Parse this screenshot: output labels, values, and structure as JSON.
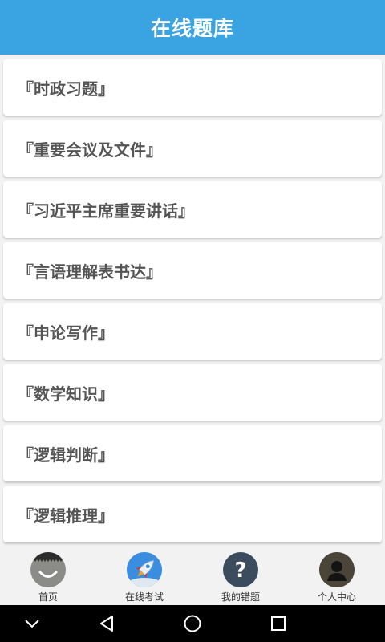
{
  "header": {
    "title": "在线题库"
  },
  "list": {
    "items": [
      {
        "label": "『时政习题』"
      },
      {
        "label": "『重要会议及文件』"
      },
      {
        "label": "『习近平主席重要讲话』"
      },
      {
        "label": "『言语理解表书达』"
      },
      {
        "label": "『申论写作』"
      },
      {
        "label": "『数学知识』"
      },
      {
        "label": "『逻辑判断』"
      },
      {
        "label": "『逻辑推理』"
      }
    ]
  },
  "tabbar": {
    "tabs": [
      {
        "label": "首页",
        "icon": "smile-face-icon"
      },
      {
        "label": "在线考试",
        "icon": "rocket-icon"
      },
      {
        "label": "我的错题",
        "icon": "question-mark-icon"
      },
      {
        "label": "个人中心",
        "icon": "person-icon"
      }
    ]
  },
  "navbar": {
    "buttons": [
      "collapse-icon",
      "back-icon",
      "home-icon",
      "recents-icon"
    ]
  },
  "colors": {
    "header": "#3aa4e3",
    "background": "#f2f2f2",
    "item_text": "#555555"
  }
}
